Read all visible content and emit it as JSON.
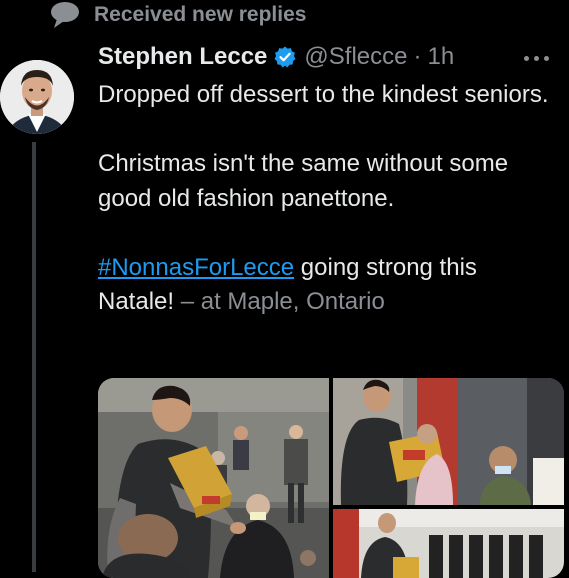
{
  "context": {
    "text": "Received new replies",
    "icon": "speech-bubble-icon"
  },
  "tweet": {
    "display_name": "Stephen Lecce",
    "verified_icon": "verified-badge-icon",
    "handle": "@Sflecce",
    "separator": "·",
    "time": "1h",
    "more_icon": "more-options-icon",
    "body": {
      "line1": "Dropped off dessert to the kindest seniors.",
      "line2": "Christmas isn't the same without some good old fashion panettone.",
      "hashtag": "#NonnasForLecce",
      "line3_rest": " going strong this Natale!",
      "location": " – at Maple, Ontario"
    },
    "media_count": 3
  },
  "colors": {
    "background": "#000000",
    "text": "#e7e9ea",
    "secondary": "#8b8f94",
    "link": "#1d9bf0",
    "verified": "#1d9bf0"
  }
}
